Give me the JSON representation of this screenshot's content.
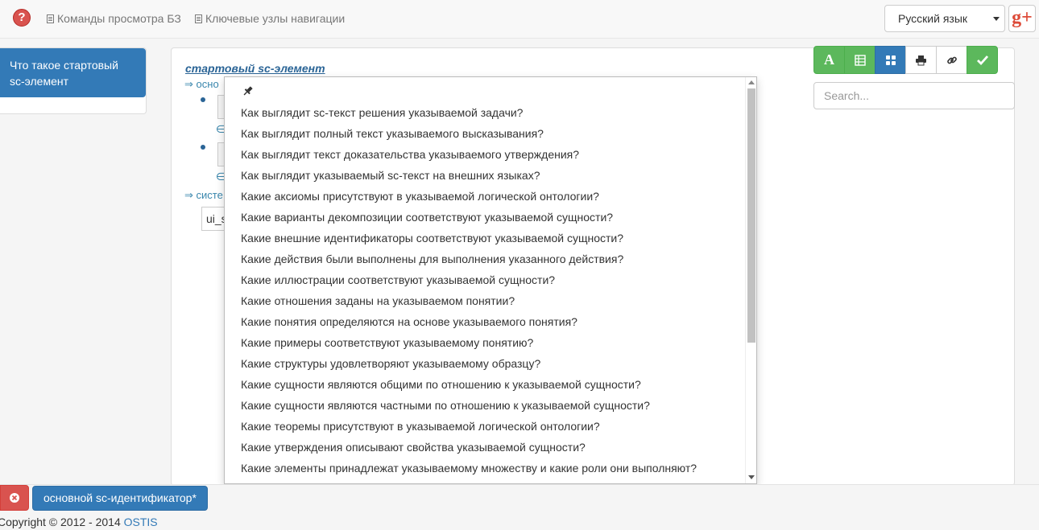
{
  "navbar": {
    "help_icon": "question-circle-icon",
    "help_symbol": "?",
    "links": [
      {
        "label": "Команды просмотра БЗ",
        "icon": "document-list-icon"
      },
      {
        "label": "Ключевые узлы навигации",
        "icon": "document-list-icon"
      }
    ],
    "language": "Русский язык",
    "gplus_label": "g+"
  },
  "sidebar": {
    "active_item": "Что такое стартовый sc-элемент"
  },
  "main": {
    "title": "стартовый sc-элемент",
    "line1_prefix": "⇒",
    "line1_text": "осно",
    "line2_prefix": "⇒",
    "line2_text": "систе",
    "stub_symbol": "∈",
    "stub_box_text": "ui_s"
  },
  "toolbar": {
    "buttons": [
      {
        "name": "text-mode",
        "icon": "letter-a-icon",
        "glyph": "A",
        "color": "#5cb85c"
      },
      {
        "name": "table-mode",
        "icon": "table-icon",
        "color": "#5cb85c"
      },
      {
        "name": "graph-mode",
        "icon": "grid-icon",
        "color": "#337ab7"
      },
      {
        "name": "print",
        "icon": "print-icon",
        "color": "#ffffff"
      },
      {
        "name": "link",
        "icon": "link-icon",
        "color": "#ffffff"
      },
      {
        "name": "confirm",
        "icon": "check-icon",
        "color": "#5cb85c"
      }
    ],
    "search_placeholder": "Search..."
  },
  "dropdown": {
    "pin_icon": "pin-icon",
    "items": [
      "Как выглядит sc-текст решения указываемой задачи?",
      "Как выглядит полный текст указываемого высказывания?",
      "Как выглядит текст доказательства указываемого утверждения?",
      "Как выглядит указываемый sc-текст на внешних языках?",
      "Какие аксиомы присутствуют в указываемой логической онтологии?",
      "Какие варианты декомпозиции соответствуют указываемой сущности?",
      "Какие внешние идентификаторы соответствуют указываемой сущности?",
      "Какие действия были выполнены для выполнения указанного действия?",
      "Какие иллюстрации соответствуют указываемой сущности?",
      "Какие отношения заданы на указываемом понятии?",
      "Какие понятия определяются на основе указываемого понятия?",
      "Какие примеры соответствуют указываемому понятию?",
      "Какие структуры удовлетворяют указываемому образцу?",
      "Какие сущности являются общими по отношению к указываемой сущности?",
      "Какие сущности являются частными по отношению к указываемой сущности?",
      "Какие теоремы присутствуют в указываемой логической онтологии?",
      "Какие утверждения описывают свойства указываемой сущности?",
      "Какие элементы принадлежат указываемому множеству и какие роли они выполняют?"
    ]
  },
  "bottom": {
    "close_icon": "close-circle-icon",
    "history_item": "основной sc-идентификатор*"
  },
  "footer": {
    "copyright": "Copyright © 2012 - 2014 ",
    "link": "OSTIS"
  },
  "colors": {
    "primary": "#337ab7",
    "success": "#5cb85c",
    "danger": "#d9534f"
  }
}
